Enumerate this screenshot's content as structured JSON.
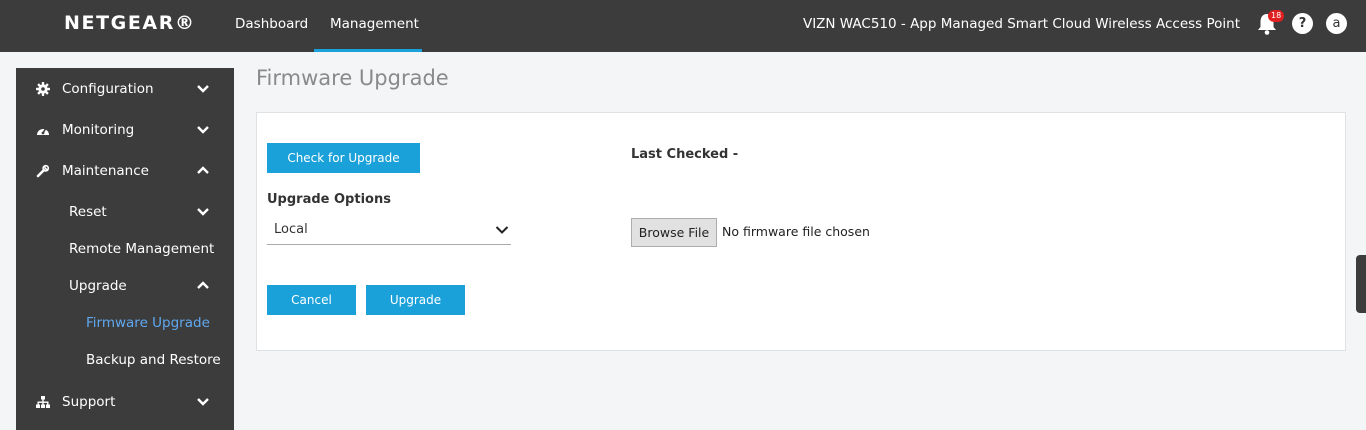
{
  "header": {
    "logo": "NETGEAR®",
    "tabs": [
      {
        "label": "Dashboard",
        "active": false
      },
      {
        "label": "Management",
        "active": true
      }
    ],
    "device_title": "VIZN WAC510 - App Managed Smart Cloud Wireless Access Point",
    "notification_count": "18",
    "help_label": "?",
    "user_initial": "a"
  },
  "sidebar": {
    "items": [
      {
        "label": "Configuration",
        "icon": "gear-icon",
        "expanded": false
      },
      {
        "label": "Monitoring",
        "icon": "dashboard-gauge-icon",
        "expanded": false
      },
      {
        "label": "Maintenance",
        "icon": "wrench-icon",
        "expanded": true
      },
      {
        "label": "Reset",
        "expanded": false
      },
      {
        "label": "Remote Management"
      },
      {
        "label": "Upgrade",
        "expanded": true
      },
      {
        "label": "Firmware Upgrade",
        "selected": true
      },
      {
        "label": "Backup and Restore"
      },
      {
        "label": "Support",
        "icon": "sitemap-icon",
        "expanded": false
      }
    ]
  },
  "main": {
    "title": "Firmware Upgrade",
    "check_button": "Check for Upgrade",
    "last_checked_label": "Last Checked -",
    "upgrade_options_label": "Upgrade Options",
    "upgrade_option_selected": "Local",
    "browse_button": "Browse File",
    "file_status": "No firmware file chosen",
    "cancel_button": "Cancel",
    "upgrade_button": "Upgrade"
  },
  "colors": {
    "topbar": "#3c3c3c",
    "accent": "#1ba1d9",
    "selected_link": "#5fa8f0",
    "badge": "#e02020"
  }
}
